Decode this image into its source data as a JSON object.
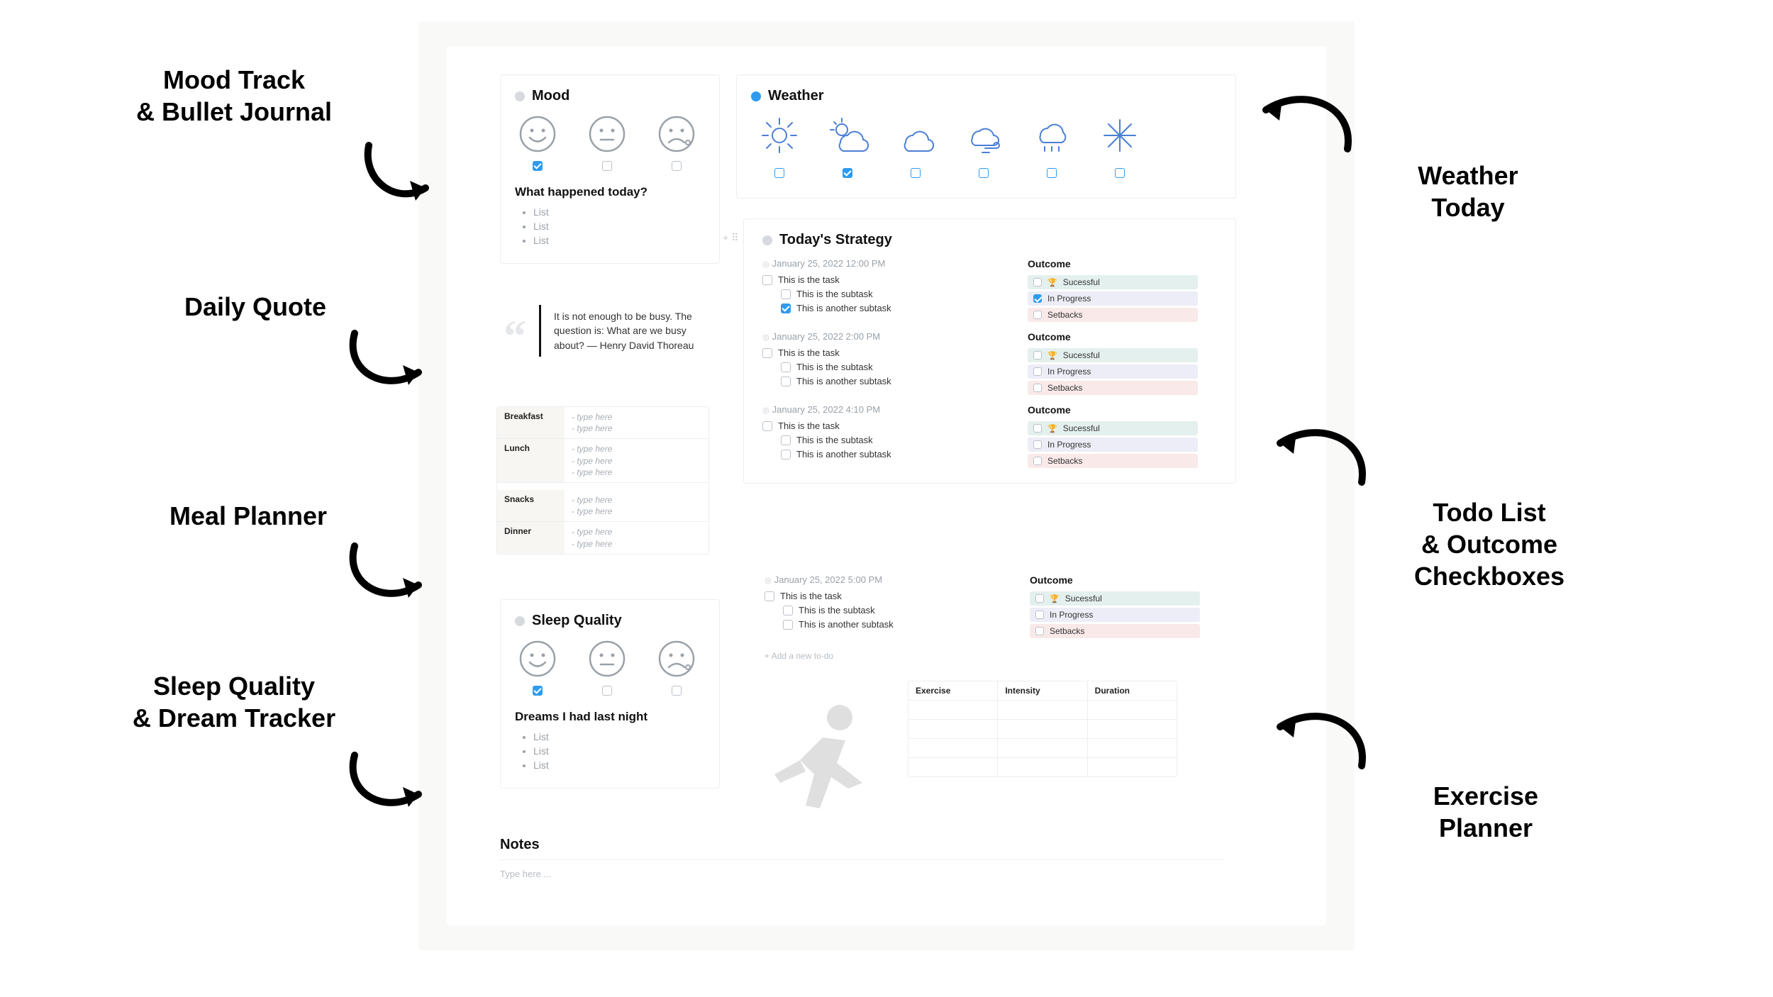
{
  "labels": {
    "mood": "Mood Track\n& Bullet Journal",
    "quote": "Daily Quote",
    "meal": "Meal Planner",
    "sleep": "Sleep Quality\n& Dream Tracker",
    "weather": "Weather\nToday",
    "todo": "Todo List\n& Outcome\nCheckboxes",
    "exercise": "Exercise\nPlanner"
  },
  "mood": {
    "title": "Mood",
    "faces": [
      {
        "name": "happy-face-icon",
        "checked": true
      },
      {
        "name": "neutral-face-icon",
        "checked": false
      },
      {
        "name": "sad-face-icon",
        "checked": false
      }
    ],
    "journal_title": "What happened today?",
    "bullets": [
      "List",
      "List",
      "List"
    ]
  },
  "weather": {
    "title": "Weather",
    "items": [
      {
        "name": "sun-icon",
        "checked": false
      },
      {
        "name": "partly-cloudy-icon",
        "checked": true
      },
      {
        "name": "cloudy-icon",
        "checked": false
      },
      {
        "name": "wind-icon",
        "checked": false
      },
      {
        "name": "rain-icon",
        "checked": false
      },
      {
        "name": "snow-icon",
        "checked": false
      }
    ]
  },
  "quote": {
    "text": "It is not enough to be busy. The question is: What are we busy about? — Henry David Thoreau"
  },
  "meals": {
    "rows": [
      {
        "label": "Breakfast",
        "lines": [
          "- type here",
          "- type here"
        ]
      },
      {
        "label": "Lunch",
        "lines": [
          "- type here",
          "- type here",
          "- type here"
        ]
      },
      {
        "label": "Snacks",
        "lines": [
          "- type here",
          "- type here"
        ]
      },
      {
        "label": "Dinner",
        "lines": [
          "- type here",
          "- type here"
        ]
      }
    ]
  },
  "sleep": {
    "title": "Sleep Quality",
    "faces": [
      {
        "name": "happy-face-icon",
        "checked": true
      },
      {
        "name": "neutral-face-icon",
        "checked": false
      },
      {
        "name": "sad-face-icon",
        "checked": false
      }
    ],
    "dreams_title": "Dreams I had last night",
    "bullets": [
      "List",
      "List",
      "List"
    ]
  },
  "strategy": {
    "title": "Today's Strategy",
    "outcome_label": "Outcome",
    "outcomes": {
      "success": "Sucessful",
      "progress": "In Progress",
      "setbacks": "Setbacks"
    },
    "slots": [
      {
        "time": "January 25, 2022 12:00 PM",
        "tasks": [
          {
            "text": "This is the task",
            "checked": false,
            "sub": false
          },
          {
            "text": "This is the subtask",
            "checked": false,
            "sub": true
          },
          {
            "text": "This is another subtask",
            "checked": true,
            "sub": true
          }
        ],
        "outcome_checked": "progress"
      },
      {
        "time": "January 25, 2022 2:00 PM",
        "tasks": [
          {
            "text": "This is the task",
            "checked": false,
            "sub": false
          },
          {
            "text": "This is the subtask",
            "checked": false,
            "sub": true
          },
          {
            "text": "This is another subtask",
            "checked": false,
            "sub": true
          }
        ],
        "outcome_checked": null
      },
      {
        "time": "January 25, 2022 4:10 PM",
        "tasks": [
          {
            "text": "This is the task",
            "checked": false,
            "sub": false
          },
          {
            "text": "This is the subtask",
            "checked": false,
            "sub": true
          },
          {
            "text": "This is another subtask",
            "checked": false,
            "sub": true
          }
        ],
        "outcome_checked": null
      }
    ],
    "extra": {
      "time": "January 25, 2022 5:00 PM",
      "tasks": [
        {
          "text": "This is the task",
          "checked": false,
          "sub": false
        },
        {
          "text": "This is the subtask",
          "checked": false,
          "sub": true
        },
        {
          "text": "This is another subtask",
          "checked": false,
          "sub": true
        }
      ]
    },
    "add_label": "Add a new to-do"
  },
  "exercise": {
    "headers": [
      "Exercise",
      "Intensity",
      "Duration"
    ],
    "rows": 4
  },
  "notes": {
    "title": "Notes",
    "placeholder": "Type here ..."
  }
}
